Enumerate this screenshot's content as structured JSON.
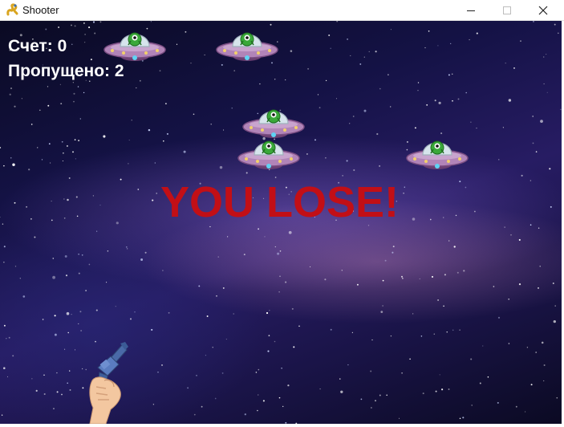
{
  "window": {
    "title": "Shooter",
    "app_icon": "pygame-snake-icon",
    "controls": [
      "minimize-icon",
      "maximize-icon",
      "close-icon"
    ]
  },
  "hud": {
    "score_label": "Счет: 0",
    "missed_label": "Пропущено: 2"
  },
  "game_over_text": "YOU LOSE!",
  "enemies": {
    "sprite": "ufo-alien-icon",
    "count": 5
  },
  "player": {
    "sprite": "hand-pistol-icon"
  },
  "colors": {
    "lose_text": "#c20f16",
    "hud_text": "#ffffff",
    "ufo_body": "#b184b8",
    "alien": "#3aa83a"
  }
}
